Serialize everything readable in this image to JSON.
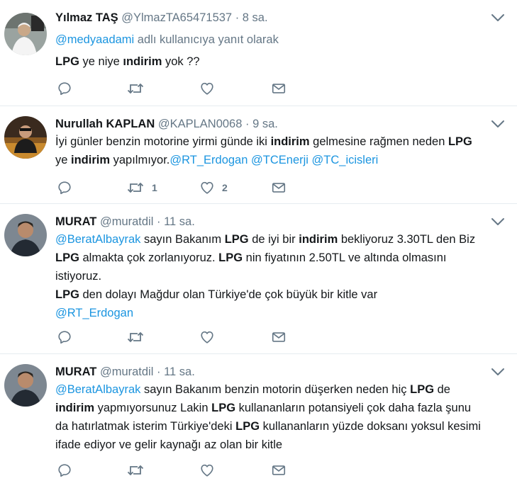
{
  "tweets": [
    {
      "name": "Yılmaz TAŞ",
      "handle": "@YlmazTA65471537",
      "separator": "·",
      "time": "8 sa.",
      "reply_to": {
        "mention": "@medyaadami",
        "suffix": " adlı kullanıcıya yanıt olarak"
      },
      "lines": [
        [
          {
            "t": "LPG",
            "s": "kw"
          },
          {
            "t": " ye niye ",
            "s": ""
          },
          {
            "t": "ındirim",
            "s": "kw"
          },
          {
            "t": " yok ??",
            "s": ""
          }
        ]
      ],
      "retweets": "",
      "likes": ""
    },
    {
      "name": "Nurullah KAPLAN",
      "handle": "@KAPLAN0068",
      "separator": "·",
      "time": "9 sa.",
      "lines": [
        [
          {
            "t": "İyi günler benzin motorine yirmi günde iki ",
            "s": ""
          },
          {
            "t": "indirim",
            "s": "kw"
          },
          {
            "t": " gelmesine rağmen neden ",
            "s": ""
          },
          {
            "t": "LPG",
            "s": "kw"
          }
        ],
        [
          {
            "t": "ye ",
            "s": ""
          },
          {
            "t": "indirim",
            "s": "kw"
          },
          {
            "t": " yapılmıyor.",
            "s": ""
          },
          {
            "t": "@RT_Erdogan",
            "s": "mention"
          },
          {
            "t": " ",
            "s": ""
          },
          {
            "t": "@TCEnerji",
            "s": "mention"
          },
          {
            "t": " ",
            "s": ""
          },
          {
            "t": "@TC_icisleri",
            "s": "mention"
          }
        ]
      ],
      "retweets": "1",
      "likes": "2"
    },
    {
      "name": "MURAT",
      "handle": "@muratdil",
      "separator": "·",
      "time": "11 sa.",
      "lines": [
        [
          {
            "t": "@BeratAlbayrak",
            "s": "mention"
          },
          {
            "t": " sayın Bakanım ",
            "s": ""
          },
          {
            "t": "LPG",
            "s": "kw"
          },
          {
            "t": " de iyi bir ",
            "s": ""
          },
          {
            "t": "indirim",
            "s": "kw"
          },
          {
            "t": " bekliyoruz 3.30TL den Biz",
            "s": ""
          }
        ],
        [
          {
            "t": "LPG",
            "s": "kw"
          },
          {
            "t": " almakta çok zorlanıyoruz. ",
            "s": ""
          },
          {
            "t": "LPG",
            "s": "kw"
          },
          {
            "t": " nin fiyatının 2.50TL ve altında olmasını",
            "s": ""
          }
        ],
        [
          {
            "t": "istiyoruz.",
            "s": ""
          }
        ],
        [
          {
            "t": "LPG",
            "s": "kw"
          },
          {
            "t": " den dolayı Mağdur olan Türkiye'de çok büyük bir kitle var",
            "s": ""
          }
        ],
        [
          {
            "t": "@RT_Erdogan",
            "s": "mention"
          }
        ]
      ],
      "retweets": "",
      "likes": ""
    },
    {
      "name": "MURAT",
      "handle": "@muratdil",
      "separator": "·",
      "time": "11 sa.",
      "lines": [
        [
          {
            "t": "@BeratAlbayrak",
            "s": "mention"
          },
          {
            "t": " sayın Bakanım benzin motorin düşerken neden hiç ",
            "s": ""
          },
          {
            "t": "LPG",
            "s": "kw"
          },
          {
            "t": " de",
            "s": ""
          }
        ],
        [
          {
            "t": "indirim",
            "s": "kw"
          },
          {
            "t": " yapmıyorsunuz Lakin ",
            "s": ""
          },
          {
            "t": "LPG",
            "s": "kw"
          },
          {
            "t": " kullananların potansiyeli çok daha fazla şunu",
            "s": ""
          }
        ],
        [
          {
            "t": "da hatırlatmak isterim Türkiye'deki ",
            "s": ""
          },
          {
            "t": "LPG",
            "s": "kw"
          },
          {
            "t": " kullananların yüzde doksanı yoksul kesimi",
            "s": ""
          }
        ],
        [
          {
            "t": "ifade ediyor ve gelir kaynağı az olan bir kitle",
            "s": ""
          }
        ]
      ],
      "retweets": "",
      "likes": ""
    }
  ],
  "icons": [
    "reply-icon",
    "retweet-icon",
    "like-icon",
    "message-icon",
    "caret-down-icon"
  ],
  "colors": {
    "name": "#14171a",
    "meta": "#657786",
    "link": "#1b95e0",
    "divider": "#e6ecf0"
  }
}
